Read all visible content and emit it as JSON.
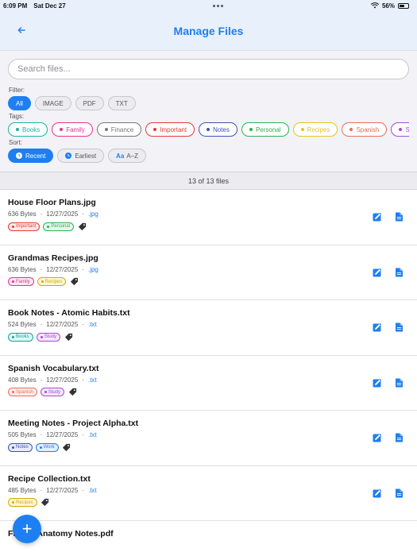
{
  "status": {
    "time": "6:09 PM",
    "date": "Sat Dec 27",
    "battery": "56%",
    "battery_level": 0.56
  },
  "nav": {
    "title": "Manage Files",
    "back_icon": "back-arrow-icon"
  },
  "search": {
    "placeholder": "Search files...",
    "value": ""
  },
  "filter": {
    "label": "Filter:",
    "options": [
      {
        "label": "All",
        "active": true
      },
      {
        "label": "IMAGE",
        "active": false
      },
      {
        "label": "PDF",
        "active": false
      },
      {
        "label": "TXT",
        "active": false
      }
    ]
  },
  "tags": {
    "label": "Tags:",
    "items": [
      {
        "label": "Books",
        "color": "#16b3a8"
      },
      {
        "label": "Family",
        "color": "#e6338f"
      },
      {
        "label": "Finance",
        "color": "#777777"
      },
      {
        "label": "Important",
        "color": "#e53935"
      },
      {
        "label": "Notes",
        "color": "#3f51b5"
      },
      {
        "label": "Personal",
        "color": "#2bb24c"
      },
      {
        "label": "Recipes",
        "color": "#e8c31c"
      },
      {
        "label": "Spanish",
        "color": "#f06a5a"
      },
      {
        "label": "Stud",
        "color": "#a64ad8"
      }
    ]
  },
  "sort": {
    "label": "Sort:",
    "options": [
      {
        "label": "Recent",
        "active": true
      },
      {
        "label": "Earliest",
        "active": false
      },
      {
        "label": "A–Z",
        "active": false,
        "prefix": "Aa"
      }
    ]
  },
  "count": "13 of 13 files",
  "files": [
    {
      "name": "House Floor Plans.jpg",
      "size": "636 Bytes",
      "date": "12/27/2025",
      "ext": ".jpg",
      "tags": [
        {
          "label": "Important",
          "color": "#e53935",
          "bg": "#fde8e8"
        },
        {
          "label": "Personal",
          "color": "#2bb24c",
          "bg": "#e6f7ea"
        }
      ]
    },
    {
      "name": "Grandmas Recipes.jpg",
      "size": "636 Bytes",
      "date": "12/27/2025",
      "ext": ".jpg",
      "tags": [
        {
          "label": "Family",
          "color": "#e6338f",
          "bg": "#fde6f1"
        },
        {
          "label": "Recipes",
          "color": "#d4a900",
          "bg": "#fdf6d8"
        }
      ]
    },
    {
      "name": "Book Notes - Atomic Habits.txt",
      "size": "524 Bytes",
      "date": "12/27/2025",
      "ext": ".txt",
      "tags": [
        {
          "label": "Books",
          "color": "#16a39a",
          "bg": "#e0f6f4"
        },
        {
          "label": "Study",
          "color": "#a64ad8",
          "bg": "#f4e8fb"
        }
      ]
    },
    {
      "name": "Spanish Vocabulary.txt",
      "size": "408 Bytes",
      "date": "12/27/2025",
      "ext": ".txt",
      "tags": [
        {
          "label": "Spanish",
          "color": "#f06a5a",
          "bg": "#fdeceb"
        },
        {
          "label": "Study",
          "color": "#a64ad8",
          "bg": "#f4e8fb"
        }
      ]
    },
    {
      "name": "Meeting Notes - Project Alpha.txt",
      "size": "505 Bytes",
      "date": "12/27/2025",
      "ext": ".txt",
      "tags": [
        {
          "label": "Notes",
          "color": "#3f51b5",
          "bg": "#e9ebf8"
        },
        {
          "label": "Work",
          "color": "#1d7ff2",
          "bg": "#e3effd"
        }
      ]
    },
    {
      "name": "Recipe Collection.txt",
      "size": "485 Bytes",
      "date": "12/27/2025",
      "ext": ".txt",
      "tags": [
        {
          "label": "Recipes",
          "color": "#d4a900",
          "bg": "#fdf6d8"
        }
      ]
    },
    {
      "name": "Flower Anatomy Notes.pdf",
      "size": "",
      "date": "",
      "ext": "",
      "tags": []
    }
  ],
  "fab": {
    "label": "+"
  },
  "icons": {
    "tag": "tag-icon",
    "edit": "edit-icon",
    "doc": "document-icon",
    "recent": "clock-icon",
    "earliest": "clock-icon"
  }
}
